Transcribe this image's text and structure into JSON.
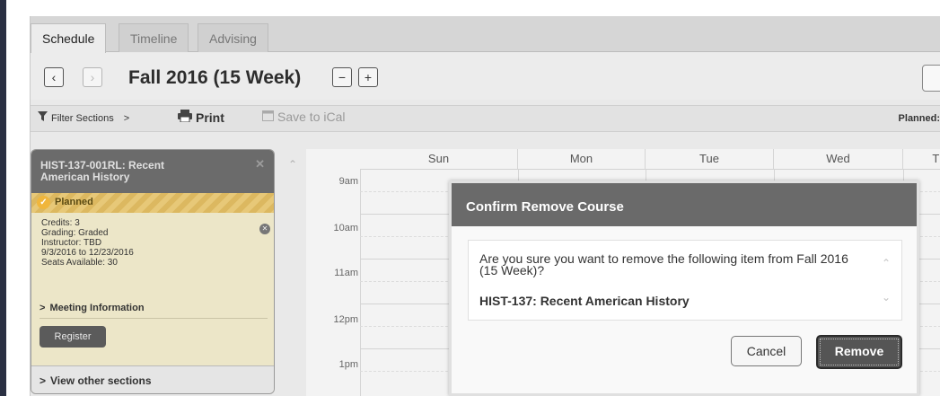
{
  "tabs": [
    {
      "label": "Schedule"
    },
    {
      "label": "Timeline"
    },
    {
      "label": "Advising"
    }
  ],
  "term": {
    "title": "Fall 2016 (15 Week)",
    "prev_icon": "chevron-left-icon",
    "next_icon": "chevron-right-icon",
    "minus_label": "−",
    "plus_label": "+"
  },
  "toolbar": {
    "filter_label": "Filter Sections",
    "filter_arrow": ">",
    "print_label": "Print",
    "ical_label": "Save to iCal",
    "planned_label": "Planned:"
  },
  "course": {
    "title": "HIST-137-001RL: Recent American History",
    "status": "Planned",
    "details": [
      "Credits: 3",
      "Grading: Graded",
      "Instructor: TBD",
      "9/3/2016 to 12/23/2016",
      "Seats Available:  30"
    ],
    "meeting_label": "Meeting Information",
    "register_label": "Register",
    "view_other_label": "View other sections"
  },
  "calendar": {
    "days": [
      "Sun",
      "Mon",
      "Tue",
      "Wed",
      "Th"
    ],
    "times": [
      "9am",
      "10am",
      "11am",
      "12pm",
      "1pm"
    ]
  },
  "modal": {
    "title": "Confirm Remove Course",
    "message": "Are you sure you want to remove the following item from Fall 2016 (15 Week)?",
    "item": "HIST-137: Recent American History",
    "cancel_label": "Cancel",
    "remove_label": "Remove"
  },
  "colors": {
    "header_gray": "#6a6a6a",
    "planned_gold": "#f0b63c",
    "sidebar_dark": "#2a3043"
  }
}
